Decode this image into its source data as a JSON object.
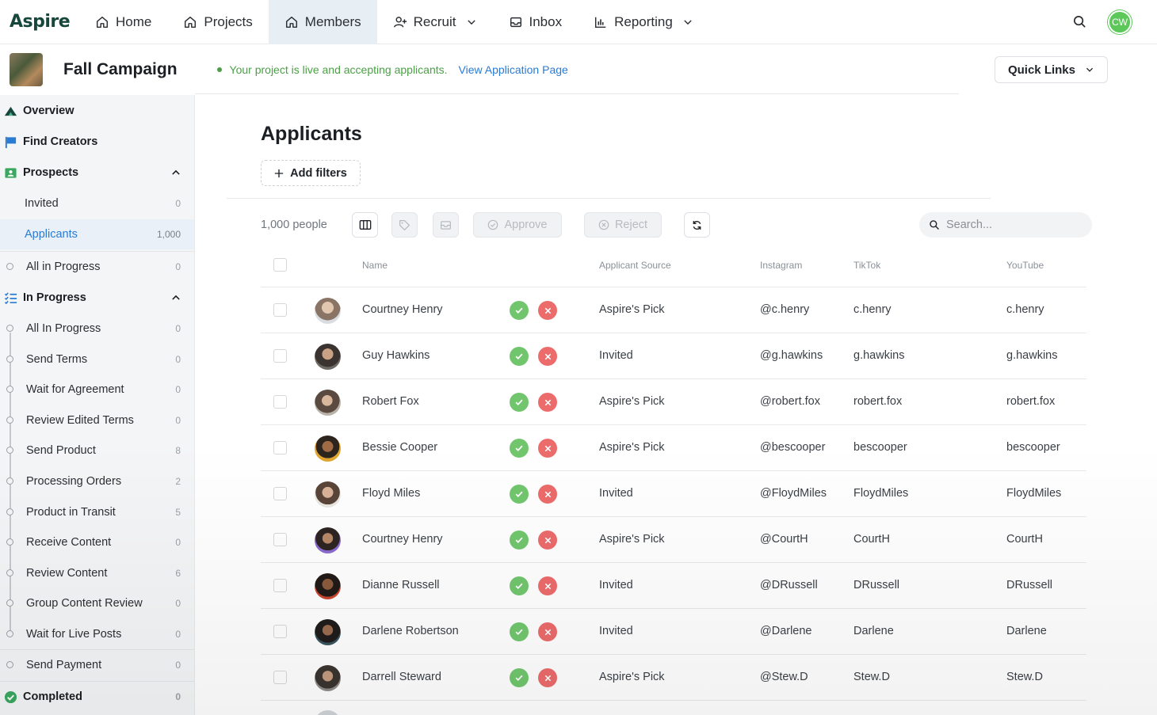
{
  "nav": {
    "logo": "Aspire",
    "items": [
      {
        "label": "Home",
        "icon": "home-icon"
      },
      {
        "label": "Projects",
        "icon": "home-icon"
      },
      {
        "label": "Members",
        "icon": "home-icon",
        "active": true
      },
      {
        "label": "Recruit",
        "icon": "add-user-icon",
        "dropdown": true
      },
      {
        "label": "Inbox",
        "icon": "inbox-icon"
      },
      {
        "label": "Reporting",
        "icon": "bar-chart-icon",
        "dropdown": true
      }
    ],
    "user_initials": "CW",
    "accent": "#5cc85a"
  },
  "project": {
    "title": "Fall Campaign",
    "status_message": "Your project is live and accepting applicants.",
    "status_link": "View Application Page",
    "quick_links_label": "Quick Links"
  },
  "sidebar": {
    "overview": "Overview",
    "find_creators": "Find Creators",
    "prospects": {
      "label": "Prospects",
      "items": [
        {
          "label": "Invited",
          "count": "0"
        },
        {
          "label": "Applicants",
          "count": "1,000",
          "selected": true
        }
      ]
    },
    "all_in_progress_top": {
      "label": "All in Progress",
      "count": "0"
    },
    "in_progress": {
      "label": "In Progress",
      "items": [
        {
          "label": "All In Progress",
          "count": "0"
        },
        {
          "label": "Send Terms",
          "count": "0"
        },
        {
          "label": "Wait for Agreement",
          "count": "0"
        },
        {
          "label": "Review Edited Terms",
          "count": "0"
        },
        {
          "label": "Send Product",
          "count": "8"
        },
        {
          "label": "Processing Orders",
          "count": "2"
        },
        {
          "label": "Product in Transit",
          "count": "5"
        },
        {
          "label": "Receive Content",
          "count": "0"
        },
        {
          "label": "Review Content",
          "count": "6"
        },
        {
          "label": "Group Content Review",
          "count": "0"
        },
        {
          "label": "Wait for Live Posts",
          "count": "0"
        },
        {
          "label": "Send Payment",
          "count": "0"
        }
      ]
    },
    "completed": {
      "label": "Completed",
      "count": "0"
    }
  },
  "main": {
    "title": "Applicants",
    "add_filters": "Add filters",
    "people_count": "1,000 people",
    "approve_label": "Approve",
    "reject_label": "Reject",
    "search_placeholder": "Search...",
    "columns": {
      "name": "Name",
      "source": "Applicant Source",
      "instagram": "Instagram",
      "tiktok": "TikTok",
      "youtube": "YouTube"
    },
    "rows": [
      {
        "name": "Courtney Henry",
        "source": "Aspire's Pick",
        "instagram": "@c.henry",
        "tiktok": "c.henry",
        "youtube": "c.henry"
      },
      {
        "name": "Guy Hawkins",
        "source": "Invited",
        "instagram": "@g.hawkins",
        "tiktok": "g.hawkins",
        "youtube": "g.hawkins"
      },
      {
        "name": "Robert Fox",
        "source": "Aspire's Pick",
        "instagram": "@robert.fox",
        "tiktok": "robert.fox",
        "youtube": "robert.fox"
      },
      {
        "name": "Bessie Cooper",
        "source": "Aspire's Pick",
        "instagram": "@bescooper",
        "tiktok": "bescooper",
        "youtube": "bescooper"
      },
      {
        "name": "Floyd Miles",
        "source": "Invited",
        "instagram": "@FloydMiles",
        "tiktok": "FloydMiles",
        "youtube": "FloydMiles"
      },
      {
        "name": "Courtney Henry",
        "source": "Aspire's Pick",
        "instagram": "@CourtH",
        "tiktok": "CourtH",
        "youtube": "CourtH"
      },
      {
        "name": "Dianne Russell",
        "source": "Invited",
        "instagram": "@DRussell",
        "tiktok": "DRussell",
        "youtube": "DRussell"
      },
      {
        "name": "Darlene Robertson",
        "source": "Invited",
        "instagram": "@Darlene",
        "tiktok": "Darlene",
        "youtube": "Darlene"
      },
      {
        "name": "Darrell Steward",
        "source": "Aspire's Pick",
        "instagram": "@Stew.D",
        "tiktok": "Stew.D",
        "youtube": "Stew.D"
      }
    ]
  },
  "colors": {
    "approve": "#71c66d",
    "reject": "#ec6b6b",
    "link": "#2a7bd3",
    "live": "#4ba046",
    "brand": "#17463a"
  }
}
